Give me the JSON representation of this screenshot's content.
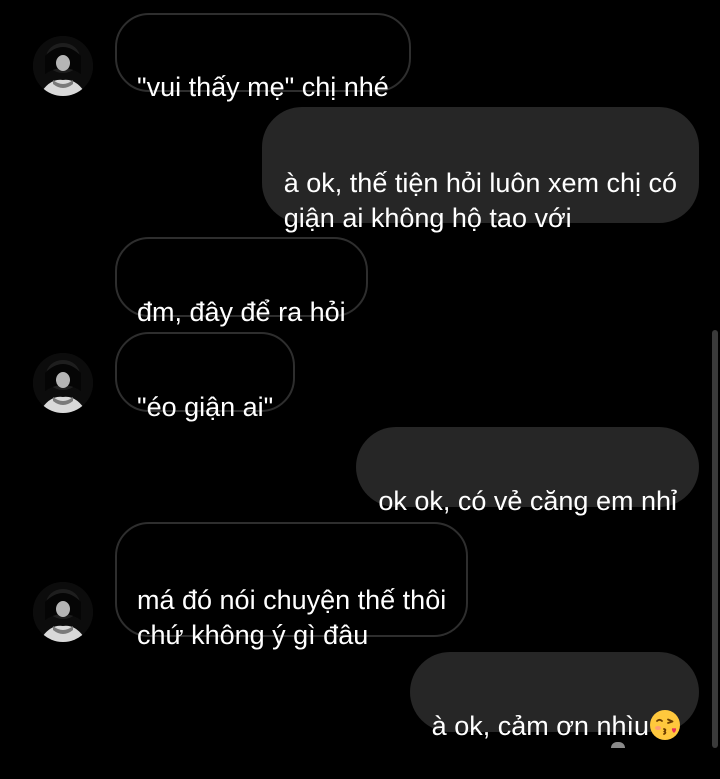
{
  "chat": {
    "messages": [
      {
        "id": 1,
        "side": "incoming",
        "text": "\"vui thấy mẹ\" chị nhé",
        "show_avatar": true
      },
      {
        "id": 2,
        "side": "outgoing",
        "text": "à ok, thế tiện hỏi luôn xem chị có\ngiận ai không hộ tao với"
      },
      {
        "id": 3,
        "side": "incoming",
        "text": "đm, đây để ra hỏi",
        "show_avatar": false
      },
      {
        "id": 4,
        "side": "incoming",
        "text": "\"éo giận ai\"",
        "show_avatar": true
      },
      {
        "id": 5,
        "side": "outgoing",
        "text": "ok ok, có vẻ căng em nhỉ"
      },
      {
        "id": 6,
        "side": "incoming",
        "text": "má đó nói chuyện thế thôi\nchứ không ý gì đâu",
        "show_avatar": true
      },
      {
        "id": 7,
        "side": "outgoing",
        "text": "à ok, cảm ơn nhìu",
        "emoji": "kissing-face-with-heart-emoji"
      }
    ]
  },
  "colors": {
    "background": "#000000",
    "incoming_border": "#2e2e2e",
    "outgoing_bubble": "#262626",
    "text": "#ffffff",
    "emoji_face": "#ffc83d",
    "emoji_heart": "#e8305a"
  }
}
